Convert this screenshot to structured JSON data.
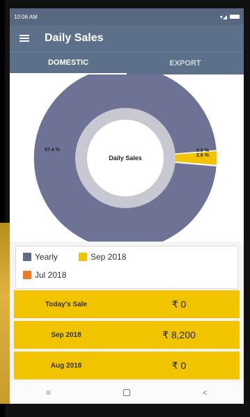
{
  "status": {
    "time": "10:06 AM"
  },
  "appbar": {
    "title": "Daily Sales"
  },
  "tabs": [
    {
      "label": "DOMESTIC",
      "active": true
    },
    {
      "label": "EXPORT",
      "active": false
    }
  ],
  "chart_data": {
    "type": "pie",
    "center_label": "Daily Sales",
    "slices": [
      {
        "label": "Yearly",
        "percent": 97.4,
        "label_text": "97.4 %",
        "color": "#6e7294"
      },
      {
        "label": "Sep 2018",
        "percent": 2.6,
        "label_text": "2.6 %",
        "color": "#f2c400"
      },
      {
        "label": "Jul 2018",
        "percent": 0.0,
        "label_text": "0.0 %",
        "color": "#ef7a21"
      }
    ]
  },
  "legend": [
    {
      "label": "Yearly",
      "color": "#5f6b88"
    },
    {
      "label": "Sep 2018",
      "color": "#f2c400"
    },
    {
      "label": "Jul 2018",
      "color": "#ef7a21"
    }
  ],
  "cards": [
    {
      "label": "Today's Sale",
      "value": "₹ 0"
    },
    {
      "label": "Sep 2018",
      "value": "₹ 8,200"
    },
    {
      "label": "Aug 2018",
      "value": "₹ 0"
    }
  ],
  "navbar": {
    "recents": "≡",
    "home": "",
    "back": "<"
  }
}
